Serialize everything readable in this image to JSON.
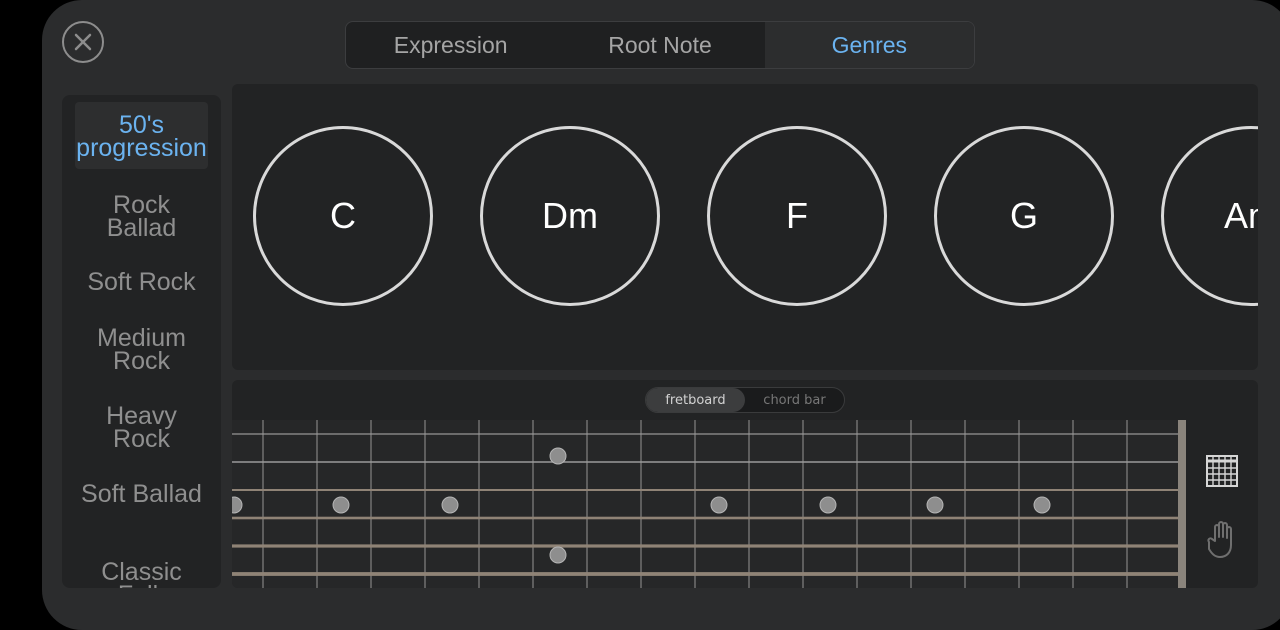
{
  "tabs": [
    {
      "label": "Expression",
      "active": false
    },
    {
      "label": "Root Note",
      "active": false
    },
    {
      "label": "Genres",
      "active": true
    }
  ],
  "genres": [
    {
      "label": "50's progression",
      "active": true
    },
    {
      "label": "Rock Ballad",
      "active": false
    },
    {
      "label": "Soft Rock",
      "active": false
    },
    {
      "label": "Medium Rock",
      "active": false
    },
    {
      "label": "Heavy Rock",
      "active": false
    },
    {
      "label": "Soft Ballad",
      "active": false
    },
    {
      "label": "Classic Folk",
      "active": false
    }
  ],
  "chords": [
    "C",
    "Dm",
    "F",
    "G",
    "Am"
  ],
  "fret_modes": [
    {
      "label": "fretboard",
      "active": true
    },
    {
      "label": "chord bar",
      "active": false
    }
  ],
  "icons": {
    "close": "close-icon",
    "grid": "chord-grid-icon",
    "hand": "hand-icon"
  },
  "colors": {
    "accent": "#6bb3f0",
    "panel": "#2b2c2d",
    "inner": "#222324"
  }
}
